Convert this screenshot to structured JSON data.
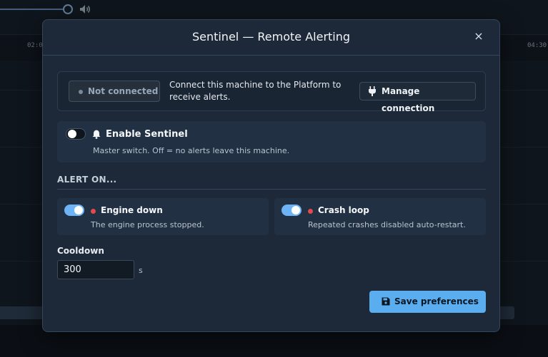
{
  "background": {
    "ticks": [
      "02:0",
      "04:30"
    ]
  },
  "modal": {
    "title": "Sentinel — Remote Alerting",
    "close_glyph": "×"
  },
  "connection": {
    "status_label": "Not connected",
    "status": "disconnected",
    "description": "Connect this machine to the Platform to receive alerts.",
    "manage_label": "Manage connection",
    "manage_icon": "plug-icon"
  },
  "master": {
    "title": "Enable Sentinel",
    "icon": "bell-icon",
    "subtitle": "Master switch. Off = no alerts leave this machine.",
    "enabled": false
  },
  "alerts": {
    "section_label": "ALERT ON...",
    "items": [
      {
        "title": "Engine down",
        "subtitle": "The engine process stopped.",
        "enabled": true,
        "severity_color": "#e5484d"
      },
      {
        "title": "Crash loop",
        "subtitle": "Repeated crashes disabled auto-restart.",
        "enabled": true,
        "severity_color": "#e5484d"
      }
    ]
  },
  "cooldown": {
    "label": "Cooldown",
    "value": "300",
    "unit": "s"
  },
  "save": {
    "label": "Save preferences",
    "icon": "floppy-disk-icon"
  },
  "colors": {
    "accent": "#5aaef0",
    "modal_bg": "#1d2938",
    "danger": "#e5484d"
  }
}
